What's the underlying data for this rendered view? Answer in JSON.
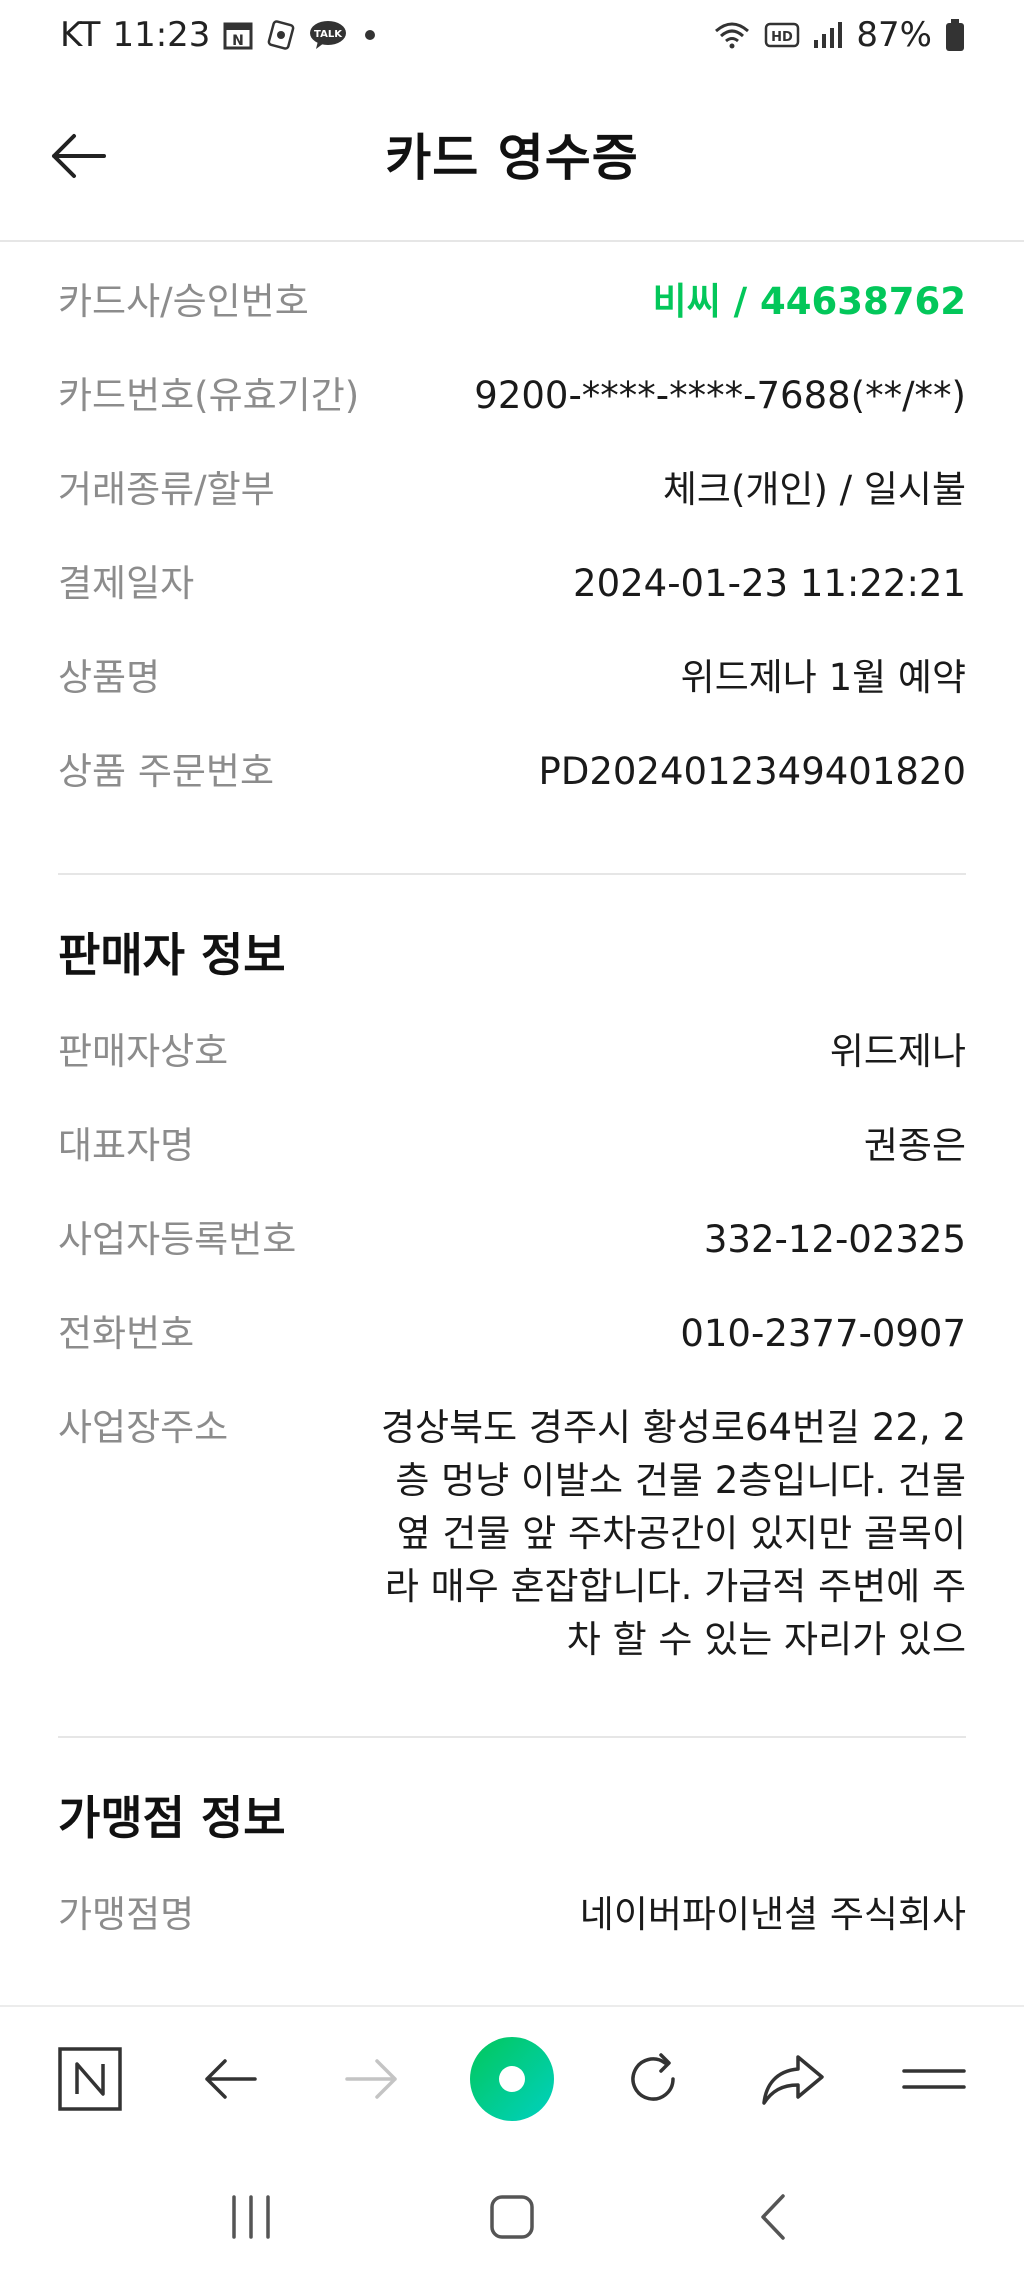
{
  "status_bar": {
    "carrier": "KT",
    "time": "11:23",
    "battery": "87%",
    "icons_left": [
      "calendar-n-icon",
      "app-icon",
      "talk-icon",
      "dot-icon"
    ],
    "icons_right": [
      "wifi-icon",
      "hd-icon",
      "signal-icon",
      "battery-icon"
    ]
  },
  "header": {
    "title": "카드 영수증"
  },
  "receipt": [
    {
      "label": "카드사/승인번호",
      "value": "비씨 / 44638762"
    },
    {
      "label": "카드번호(유효기간)",
      "value": "9200-****-****-7688(**/**)"
    },
    {
      "label": "거래종류/할부",
      "value": "체크(개인) / 일시불"
    },
    {
      "label": "결제일자",
      "value": "2024-01-23 11:22:21"
    },
    {
      "label": "상품명",
      "value": "위드제나 1월 예약"
    },
    {
      "label": "상품 주문번호",
      "value": "PD2024012349401820"
    }
  ],
  "seller": {
    "title": "판매자 정보",
    "rows": [
      {
        "label": "판매자상호",
        "value": "위드제나"
      },
      {
        "label": "대표자명",
        "value": "권종은"
      },
      {
        "label": "사업자등록번호",
        "value": "332-12-02325"
      },
      {
        "label": "전화번호",
        "value": "010-2377-0907"
      },
      {
        "label": "사업장주소",
        "value": "경상북도 경주시 황성로64번길 22, 2층 멍냥 이발소 건물 2층입니다. 건물 옆 건물 앞 주차공간이 있지만 골목이라 매우 혼잡합니다. 가급적 주변에 주차 할 수 있는 자리가 있으"
      }
    ]
  },
  "merchant": {
    "title": "가맹점 정보",
    "rows": [
      {
        "label": "가맹점명",
        "value": "네이버파이낸셜 주식회사"
      }
    ]
  },
  "browser_nav": {
    "items": [
      "naver-home-icon",
      "back-arrow-icon",
      "forward-arrow-icon",
      "green-dot-icon",
      "refresh-icon",
      "share-icon",
      "menu-icon"
    ]
  },
  "colors": {
    "accent": "#03c75a",
    "label": "#8c8c8c",
    "divider": "#e6e6e6"
  }
}
